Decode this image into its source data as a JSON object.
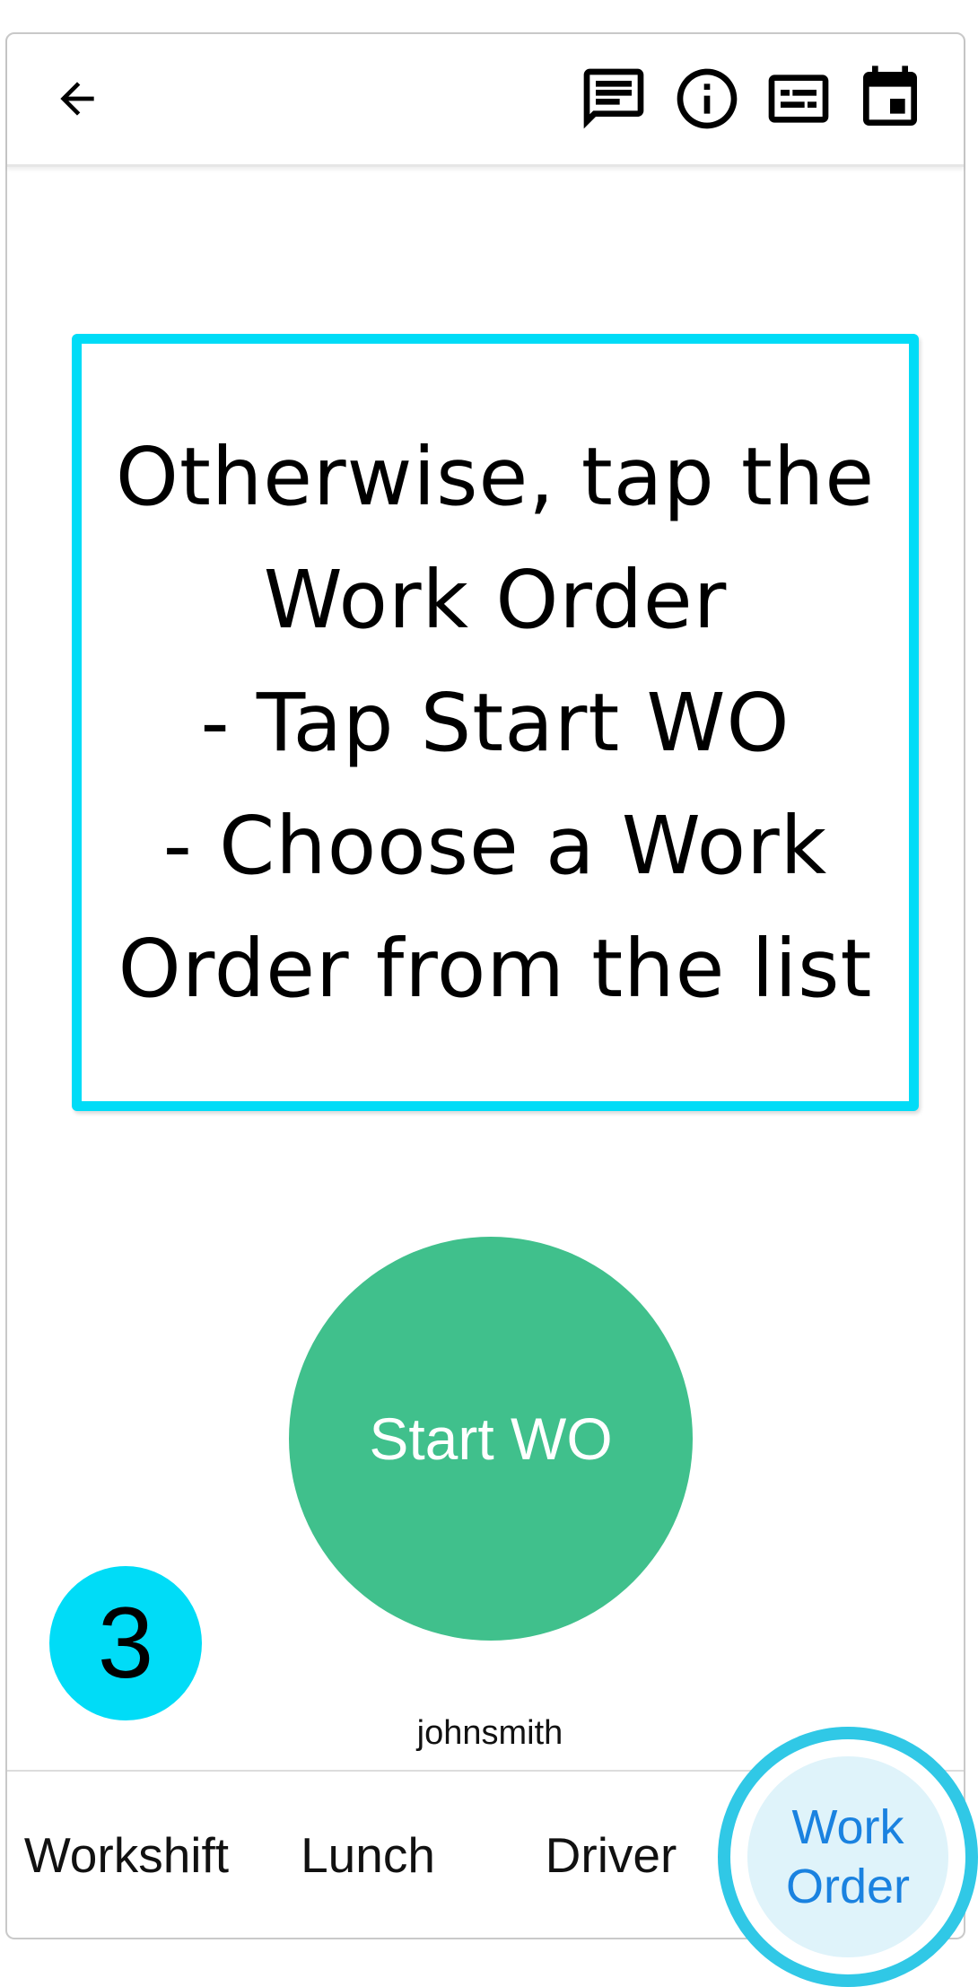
{
  "header": {
    "back_icon": "arrow-left-icon",
    "actions": [
      {
        "name": "chat",
        "icon": "message-icon"
      },
      {
        "name": "info",
        "icon": "info-icon"
      },
      {
        "name": "card",
        "icon": "card-icon"
      },
      {
        "name": "calendar",
        "icon": "calendar-icon"
      }
    ]
  },
  "callout": {
    "lines": [
      "Otherwise, tap the",
      "Work Order",
      "- Tap Start WO",
      "- Choose a Work",
      "Order from the list"
    ],
    "border_color": "#00dcf7"
  },
  "start_button": {
    "label": "Start WO",
    "color": "#40c08c"
  },
  "step_badge": {
    "number": "3",
    "color": "#00dcf7"
  },
  "username": "johnsmith",
  "bottom_nav": {
    "tabs": [
      {
        "label": "Workshift"
      },
      {
        "label": "Lunch"
      },
      {
        "label": "Driver"
      },
      {
        "label_lines": [
          "Work",
          "Order"
        ],
        "active": true,
        "color": "#1a82e0"
      }
    ]
  }
}
